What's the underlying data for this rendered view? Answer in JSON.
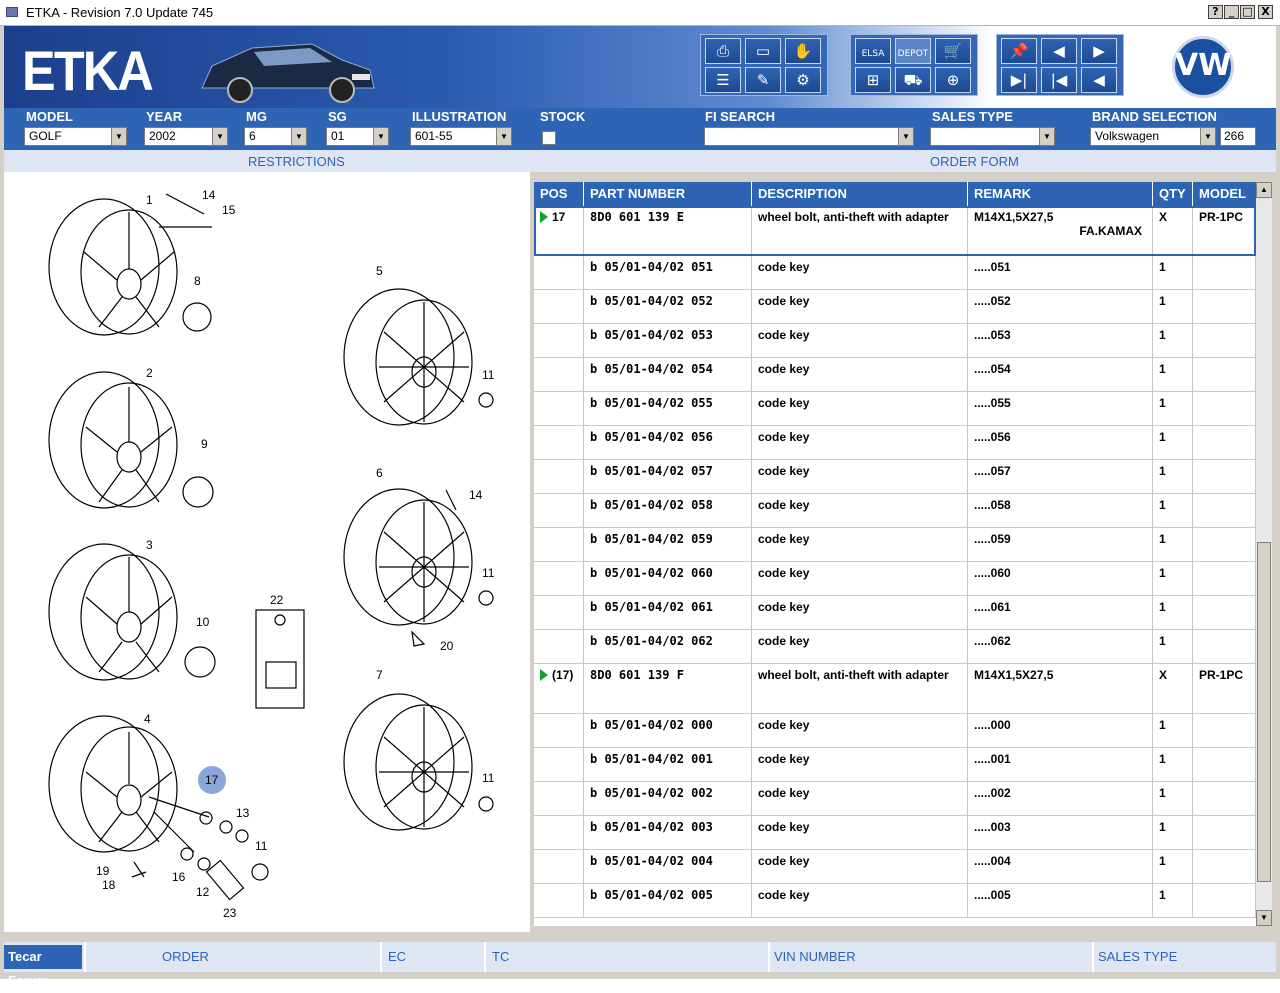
{
  "window": {
    "title": "ETKA - Revision 7.0 Update 745",
    "buttons": [
      "?",
      "_",
      "□",
      "X"
    ]
  },
  "banner": {
    "logo": "ETKA",
    "brand_logo": "VW",
    "toolbar_icons": [
      "printer-icon",
      "book-icon",
      "handshake-icon",
      "list-icon",
      "pencil-icon",
      "car-service-icon",
      "elsa-icon",
      "depot-icon",
      "cart-icon",
      "network-icon",
      "cart-plus-icon",
      "pin-icon",
      "page-prev-icon",
      "page-next-icon",
      "first-icon",
      "prev-icon",
      "back-icon"
    ],
    "toolbar_labels": {
      "elsa": "ELSA",
      "depot": "DEPOT"
    }
  },
  "filters": {
    "model": {
      "label": "MODEL",
      "value": "GOLF"
    },
    "year": {
      "label": "YEAR",
      "value": "2002"
    },
    "mg": {
      "label": "MG",
      "value": "6"
    },
    "sg": {
      "label": "SG",
      "value": "01"
    },
    "illustration": {
      "label": "ILLUSTRATION",
      "value": "601-55"
    },
    "stock": {
      "label": "STOCK"
    },
    "fi_search": {
      "label": "FI SEARCH",
      "value": ""
    },
    "sales_type": {
      "label": "SALES TYPE",
      "value": ""
    },
    "brand": {
      "label": "BRAND SELECTION",
      "value": "Volkswagen",
      "count": "266"
    }
  },
  "sections": {
    "restrictions": "RESTRICTIONS",
    "order_form": "ORDER FORM"
  },
  "illustration": {
    "callouts": [
      "1",
      "14",
      "15",
      "8",
      "5",
      "11",
      "2",
      "9",
      "6",
      "14",
      "3",
      "10",
      "22",
      "11",
      "20",
      "7",
      "4",
      "17",
      "13",
      "11",
      "11",
      "19",
      "18",
      "16",
      "12",
      "23"
    ]
  },
  "table": {
    "columns": [
      "POS",
      "PART NUMBER",
      "DESCRIPTION",
      "REMARK",
      "QTY",
      "MODEL"
    ],
    "rows": [
      {
        "pos": "17",
        "arrow": true,
        "part": "8D0 601 139 E",
        "desc": "wheel bolt, anti-theft with adapter",
        "remark": "M14X1,5X27,5",
        "remark2": "FA.KAMAX",
        "qty": "X",
        "model": "PR-1PC",
        "tall": true,
        "selected": true
      },
      {
        "pos": "",
        "part": "b 05/01-04/02 051",
        "desc": "code key",
        "remark": ".....051",
        "qty": "1",
        "model": ""
      },
      {
        "pos": "",
        "part": "b 05/01-04/02 052",
        "desc": "code key",
        "remark": ".....052",
        "qty": "1",
        "model": ""
      },
      {
        "pos": "",
        "part": "b 05/01-04/02 053",
        "desc": "code key",
        "remark": ".....053",
        "qty": "1",
        "model": ""
      },
      {
        "pos": "",
        "part": "b 05/01-04/02 054",
        "desc": "code key",
        "remark": ".....054",
        "qty": "1",
        "model": ""
      },
      {
        "pos": "",
        "part": "b 05/01-04/02 055",
        "desc": "code key",
        "remark": ".....055",
        "qty": "1",
        "model": ""
      },
      {
        "pos": "",
        "part": "b 05/01-04/02 056",
        "desc": "code key",
        "remark": ".....056",
        "qty": "1",
        "model": ""
      },
      {
        "pos": "",
        "part": "b 05/01-04/02 057",
        "desc": "code key",
        "remark": ".....057",
        "qty": "1",
        "model": ""
      },
      {
        "pos": "",
        "part": "b 05/01-04/02 058",
        "desc": "code key",
        "remark": ".....058",
        "qty": "1",
        "model": ""
      },
      {
        "pos": "",
        "part": "b 05/01-04/02 059",
        "desc": "code key",
        "remark": ".....059",
        "qty": "1",
        "model": ""
      },
      {
        "pos": "",
        "part": "b 05/01-04/02 060",
        "desc": "code key",
        "remark": ".....060",
        "qty": "1",
        "model": ""
      },
      {
        "pos": "",
        "part": "b 05/01-04/02 061",
        "desc": "code key",
        "remark": ".....061",
        "qty": "1",
        "model": ""
      },
      {
        "pos": "",
        "part": "b 05/01-04/02 062",
        "desc": "code key",
        "remark": ".....062",
        "qty": "1",
        "model": ""
      },
      {
        "pos": "(17)",
        "arrow": true,
        "part": "8D0 601 139 F",
        "desc": "wheel bolt, anti-theft with adapter",
        "remark": "M14X1,5X27,5",
        "remark2": "",
        "qty": "X",
        "model": "PR-1PC",
        "tall": true
      },
      {
        "pos": "",
        "part": "b 05/01-04/02 000",
        "desc": "code key",
        "remark": ".....000",
        "qty": "1",
        "model": ""
      },
      {
        "pos": "",
        "part": "b 05/01-04/02 001",
        "desc": "code key",
        "remark": ".....001",
        "qty": "1",
        "model": ""
      },
      {
        "pos": "",
        "part": "b 05/01-04/02 002",
        "desc": "code key",
        "remark": ".....002",
        "qty": "1",
        "model": ""
      },
      {
        "pos": "",
        "part": "b 05/01-04/02 003",
        "desc": "code key",
        "remark": ".....003",
        "qty": "1",
        "model": ""
      },
      {
        "pos": "",
        "part": "b 05/01-04/02 004",
        "desc": "code key",
        "remark": ".....004",
        "qty": "1",
        "model": ""
      },
      {
        "pos": "",
        "part": "b 05/01-04/02 005",
        "desc": "code key",
        "remark": ".....005",
        "qty": "1",
        "model": ""
      }
    ]
  },
  "bottom": {
    "forum": "Tecar Forum",
    "order": "ORDER",
    "ec": "EC",
    "tc": "TC",
    "vin": "VIN NUMBER",
    "sales_type": "SALES TYPE"
  },
  "colors": {
    "accent": "#2d64b4",
    "section_bg": "#dfe6f3",
    "arrow_green": "#10a030"
  }
}
